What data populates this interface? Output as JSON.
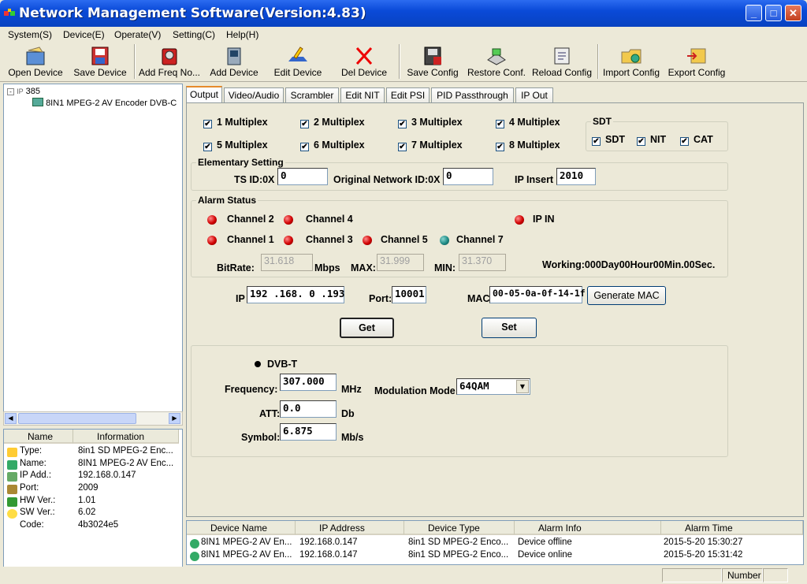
{
  "window": {
    "title": "Network Management Software(Version:4.83)"
  },
  "menu": [
    "System(S)",
    "Device(E)",
    "Operate(V)",
    "Setting(C)",
    "Help(H)"
  ],
  "toolbar": [
    "Open Device",
    "Save Device",
    "Add Freq No...",
    "Add Device",
    "Edit Device",
    "Del Device",
    "Save Config",
    "Restore Conf.",
    "Reload Config",
    "Import Config",
    "Export Config"
  ],
  "tree": {
    "root": "385",
    "child": "8IN1 MPEG-2 AV Encoder DVB-C"
  },
  "info": {
    "headers": [
      "Name",
      "Information"
    ],
    "rows": [
      {
        "k": "Type:",
        "v": "8in1 SD MPEG-2 Enc..."
      },
      {
        "k": "Name:",
        "v": "8IN1 MPEG-2 AV Enc..."
      },
      {
        "k": "IP Add.:",
        "v": "192.168.0.147"
      },
      {
        "k": "Port:",
        "v": "2009"
      },
      {
        "k": "HW Ver.:",
        "v": "1.01"
      },
      {
        "k": "SW Ver.:",
        "v": "6.02"
      },
      {
        "k": "Code:",
        "v": "4b3024e5"
      }
    ]
  },
  "tabs": [
    "Output",
    "Video/Audio",
    "Scrambler",
    "Edit NIT",
    "Edit PSI",
    "PID Passthrough",
    "IP Out"
  ],
  "multiplex": [
    "1 Multiplex",
    "2 Multiplex",
    "3 Multiplex",
    "4 Multiplex",
    "5 Multiplex",
    "6 Multiplex",
    "7 Multiplex",
    "8 Multiplex"
  ],
  "sdt": {
    "title": "SDT",
    "items": [
      "SDT",
      "NIT",
      "CAT"
    ]
  },
  "elementary": {
    "title": "Elementary Setting",
    "ts_label": "TS ID:0X",
    "ts_value": "0",
    "onid_label": "Original Network ID:0X",
    "onid_value": "0",
    "ipinsert_label": "IP Insert",
    "ipinsert_value": "2010"
  },
  "alarm": {
    "title": "Alarm Status",
    "channels": [
      "Channel 2",
      "Channel 4",
      "Channel 1",
      "Channel 3",
      "Channel 5",
      "Channel 7"
    ],
    "ipin": "IP IN",
    "bitrate_label": "BitRate:",
    "bitrate": "31.618",
    "mbps": "Mbps",
    "max_label": "MAX:",
    "max": "31.999",
    "min_label": "MIN:",
    "min": "31.370",
    "working": "Working:000Day00Hour00Min.00Sec."
  },
  "net": {
    "ip_label": "IP",
    "ip": "192 .168.  0   .193",
    "port_label": "Port:",
    "port": "10001",
    "mac_label": "MAC",
    "mac": "00-05-0a-0f-14-1f",
    "genmac": "Generate MAC"
  },
  "actions": {
    "get": "Get",
    "set": "Set"
  },
  "dvbt": {
    "radio": "DVB-T",
    "freq_label": "Frequency:",
    "freq": "307.000",
    "freq_unit": "MHz",
    "mod_label": "Modulation Mode",
    "mod": "64QAM",
    "att_label": "ATT:",
    "att": "0.0",
    "att_unit": "Db",
    "sym_label": "Symbol:",
    "sym": "6.875",
    "sym_unit": "Mb/s"
  },
  "events": {
    "headers": [
      "Device Name",
      "IP Address",
      "Device Type",
      "Alarm Info",
      "Alarm Time"
    ],
    "rows": [
      [
        "8IN1 MPEG-2 AV En...",
        "192.168.0.147",
        "8in1 SD MPEG-2 Enco...",
        "Device offline",
        "2015-5-20 15:30:27"
      ],
      [
        "8IN1 MPEG-2 AV En...",
        "192.168.0.147",
        "8in1 SD MPEG-2 Enco...",
        "Device online",
        "2015-5-20 15:31:42"
      ]
    ]
  },
  "status": {
    "number": "Number"
  }
}
